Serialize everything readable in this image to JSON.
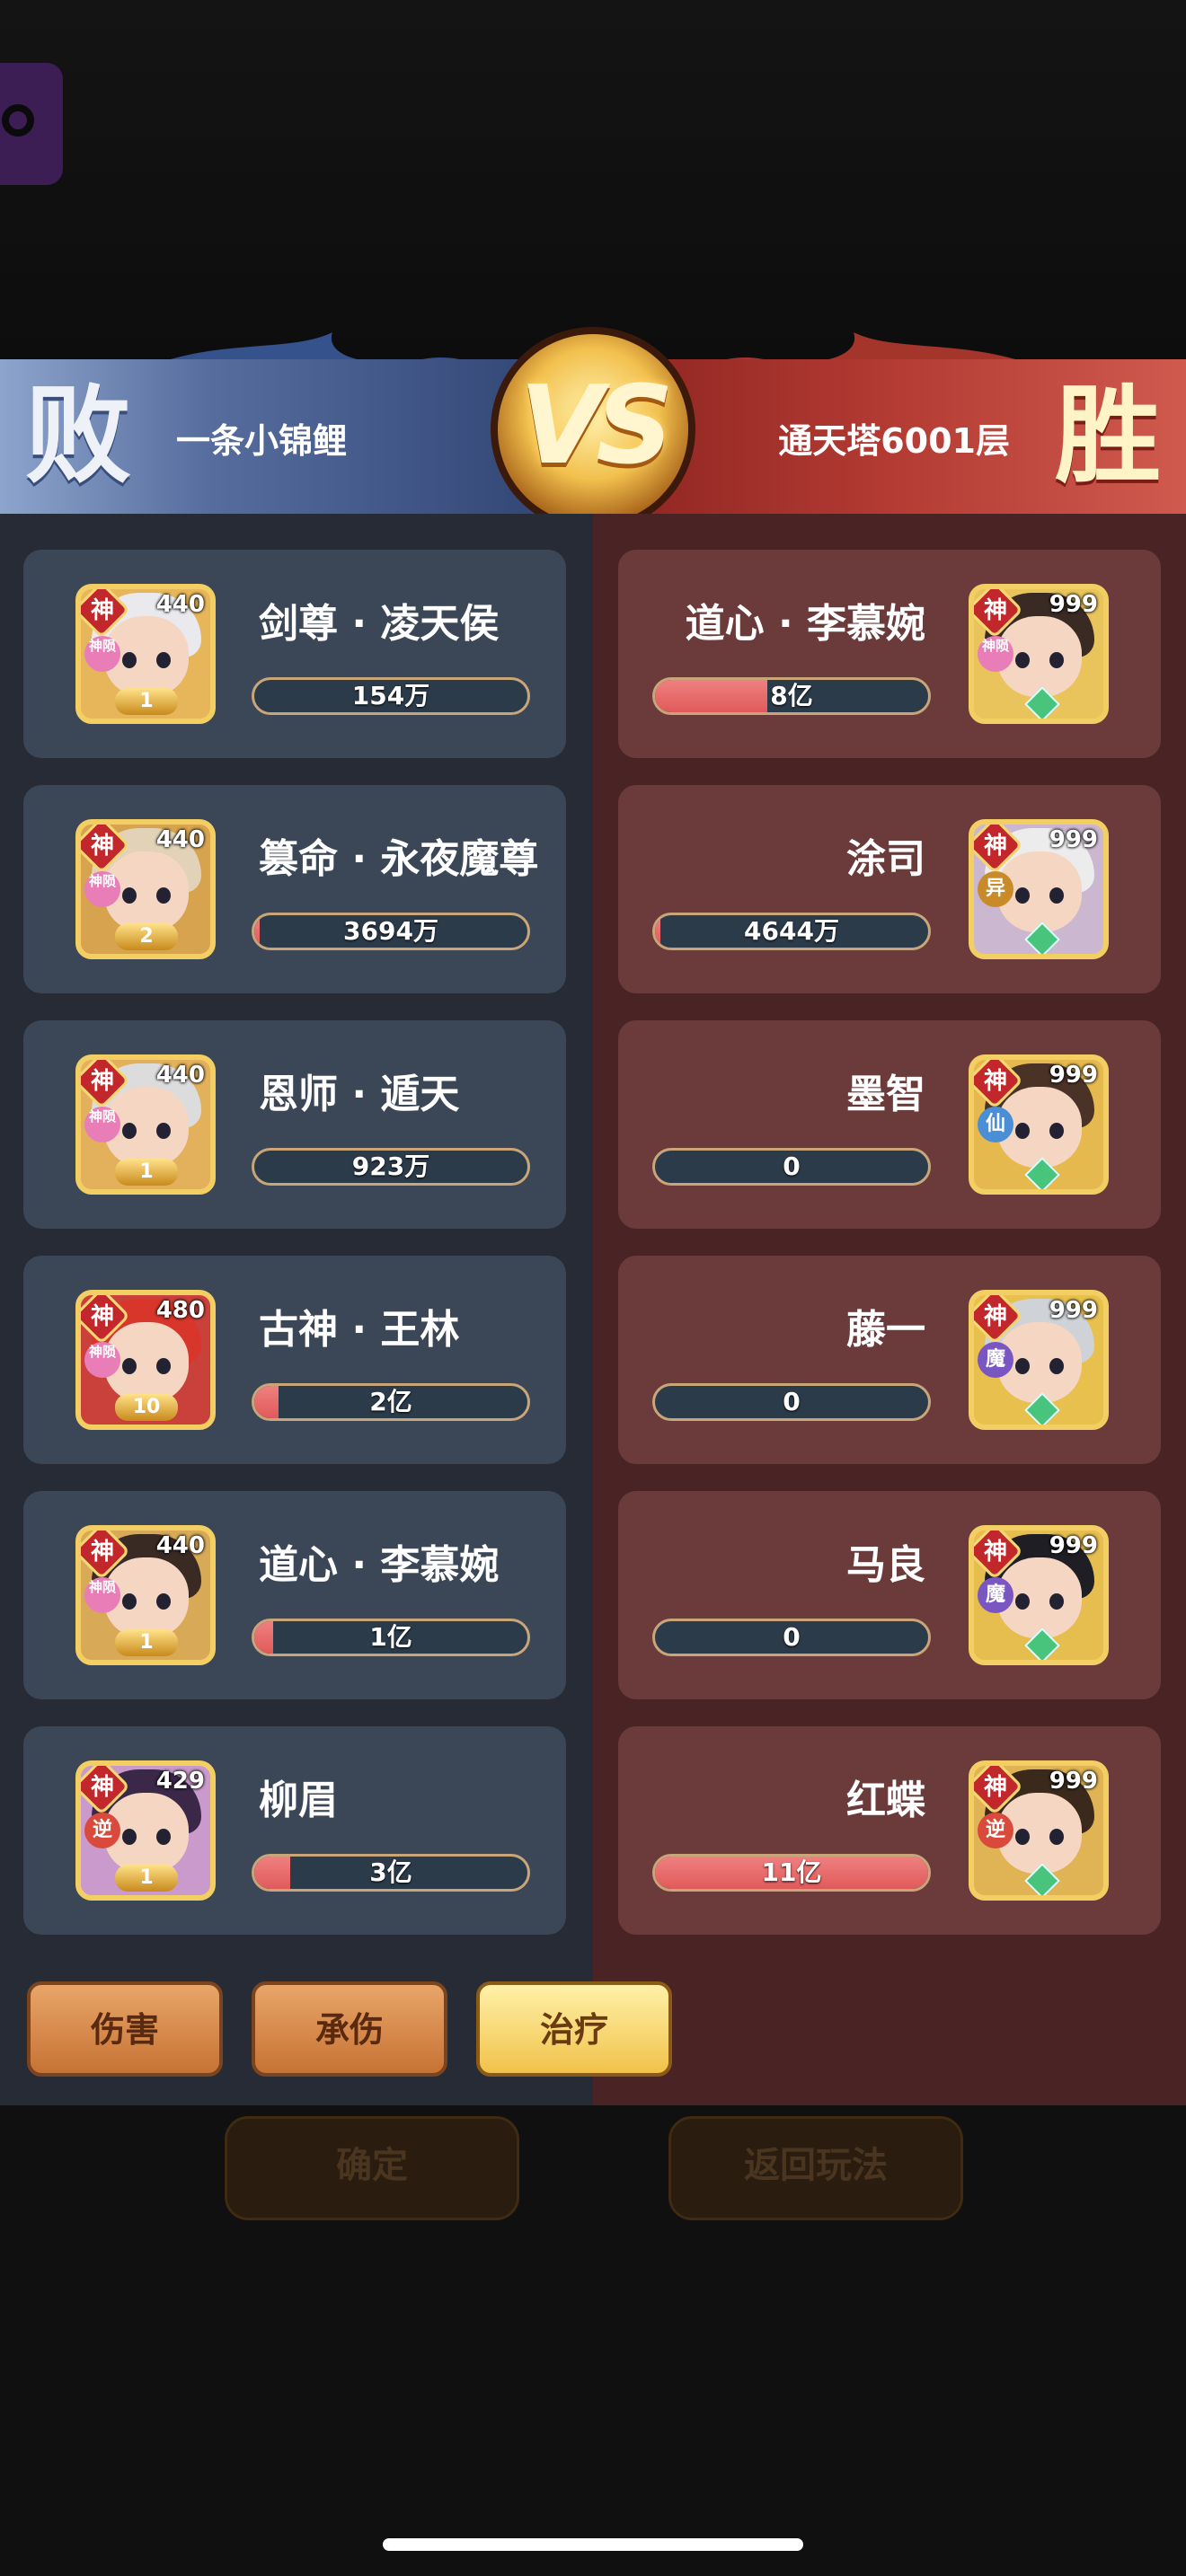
{
  "header": {
    "left_result": "败",
    "left_player": "一条小锦鲤",
    "vs": "VS",
    "right_player": "通天塔6001层",
    "right_result": "胜"
  },
  "left_team": [
    {
      "name": "剑尊 · 凌天侯",
      "level": "440",
      "badge": "神",
      "sub": "神陨",
      "stars": "1",
      "damage": "154万",
      "fill": 0.0,
      "hair": "#e9e9ee",
      "bg": "#e7b65a"
    },
    {
      "name": "篡命 · 永夜魔尊",
      "level": "440",
      "badge": "神",
      "sub": "神陨",
      "stars": "2",
      "damage": "3694万",
      "fill": 0.02,
      "hair": "#e2d3b8",
      "bg": "#d7a34e"
    },
    {
      "name": "恩师 · 遁天",
      "level": "440",
      "badge": "神",
      "sub": "神陨",
      "stars": "1",
      "damage": "923万",
      "fill": 0.0,
      "hair": "#dcdcdc",
      "bg": "#e3b05c"
    },
    {
      "name": "古神 · 王林",
      "level": "480",
      "badge": "神",
      "sub": "神陨",
      "stars": "10",
      "damage": "2亿",
      "fill": 0.09,
      "hair": "#d8352b",
      "bg": "#c9413a"
    },
    {
      "name": "道心 · 李慕婉",
      "level": "440",
      "badge": "神",
      "sub": "神陨",
      "stars": "1",
      "damage": "1亿",
      "fill": 0.07,
      "hair": "#3a2a24",
      "bg": "#d8a957"
    },
    {
      "name": "柳眉",
      "level": "429",
      "badge": "神",
      "sub": "逆",
      "stars": "1",
      "damage": "3亿",
      "fill": 0.13,
      "hair": "#3b2748",
      "bg": "#c99acb"
    }
  ],
  "right_team": [
    {
      "name": "道心 · 李慕婉",
      "level": "999",
      "badge": "神",
      "sub": "神陨",
      "damage": "8亿",
      "fill": 0.41,
      "hair": "#3a2a24",
      "bg": "#e9c35b"
    },
    {
      "name": "涂司",
      "level": "999",
      "badge": "神",
      "sub": "异",
      "damage": "4644万",
      "fill": 0.02,
      "hair": "#ececec",
      "bg": "#cbb7d0"
    },
    {
      "name": "墨智",
      "level": "999",
      "badge": "神",
      "sub": "仙",
      "damage": "0",
      "fill": 0.0,
      "hair": "#4a3326",
      "bg": "#e6b94e"
    },
    {
      "name": "藤一",
      "level": "999",
      "badge": "神",
      "sub": "魔",
      "damage": "0",
      "fill": 0.0,
      "hair": "#cfd2d6",
      "bg": "#e7c04d"
    },
    {
      "name": "马良",
      "level": "999",
      "badge": "神",
      "sub": "魔",
      "damage": "0",
      "fill": 0.0,
      "hair": "#1e1e24",
      "bg": "#e6bd4f"
    },
    {
      "name": "红蝶",
      "level": "999",
      "badge": "神",
      "sub": "逆",
      "damage": "11亿",
      "fill": 1.0,
      "hair": "#3b2a1c",
      "bg": "#e0b454"
    }
  ],
  "tabs": [
    {
      "label": "伤害",
      "active": false
    },
    {
      "label": "承伤",
      "active": false
    },
    {
      "label": "治疗",
      "active": true
    }
  ],
  "buttons": {
    "confirm": "确定",
    "back": "返回玩法"
  },
  "colors": {
    "left_panel": "#262b35",
    "right_panel": "#4a2424",
    "bar_fill": "#e96a6a",
    "gold": "#f3cf63"
  }
}
